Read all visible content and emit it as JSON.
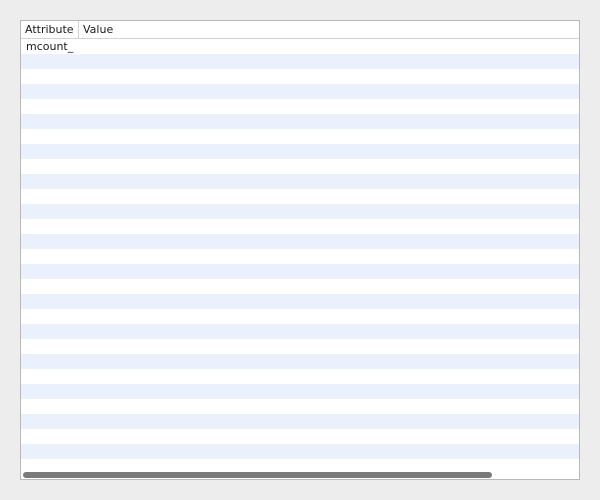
{
  "table": {
    "columns": {
      "attribute": "Attribute",
      "value": "Value"
    },
    "rows": [
      {
        "attribute": "mcount_",
        "value": ""
      }
    ]
  },
  "scrollbar": {
    "horizontal_fraction_visible": 0.84,
    "horizontal_position": 0
  }
}
